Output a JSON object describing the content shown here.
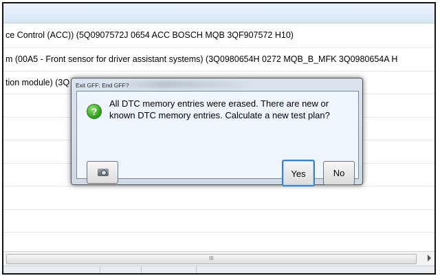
{
  "rows": [
    "ce Control (ACC)) (5Q0907572J   0654   ACC BOSCH MQB   3QF907572    H10)",
    "m (00A5 - Front sensor for driver assistant systems) (3Q0980654H   0272   MQB_B_MFK      3Q0980654A   H",
    "tion module) (3Q",
    "",
    "",
    "",
    "",
    "",
    "",
    ""
  ],
  "scrollbar": {
    "thumb_grip": "III"
  },
  "dialog": {
    "title": "Exit GFF: End GFF?",
    "message": "All DTC memory entries were erased. There are new or known DTC memory entries. Calculate a new test plan?",
    "icon": "question-icon",
    "buttons": {
      "yes": "Yes",
      "no": "No",
      "screenshot_icon": "camera-icon"
    }
  },
  "colors": {
    "accent": "#3c7fc3",
    "dialog_bg": "#eef5fc",
    "question_icon": "#2c9b1d"
  }
}
